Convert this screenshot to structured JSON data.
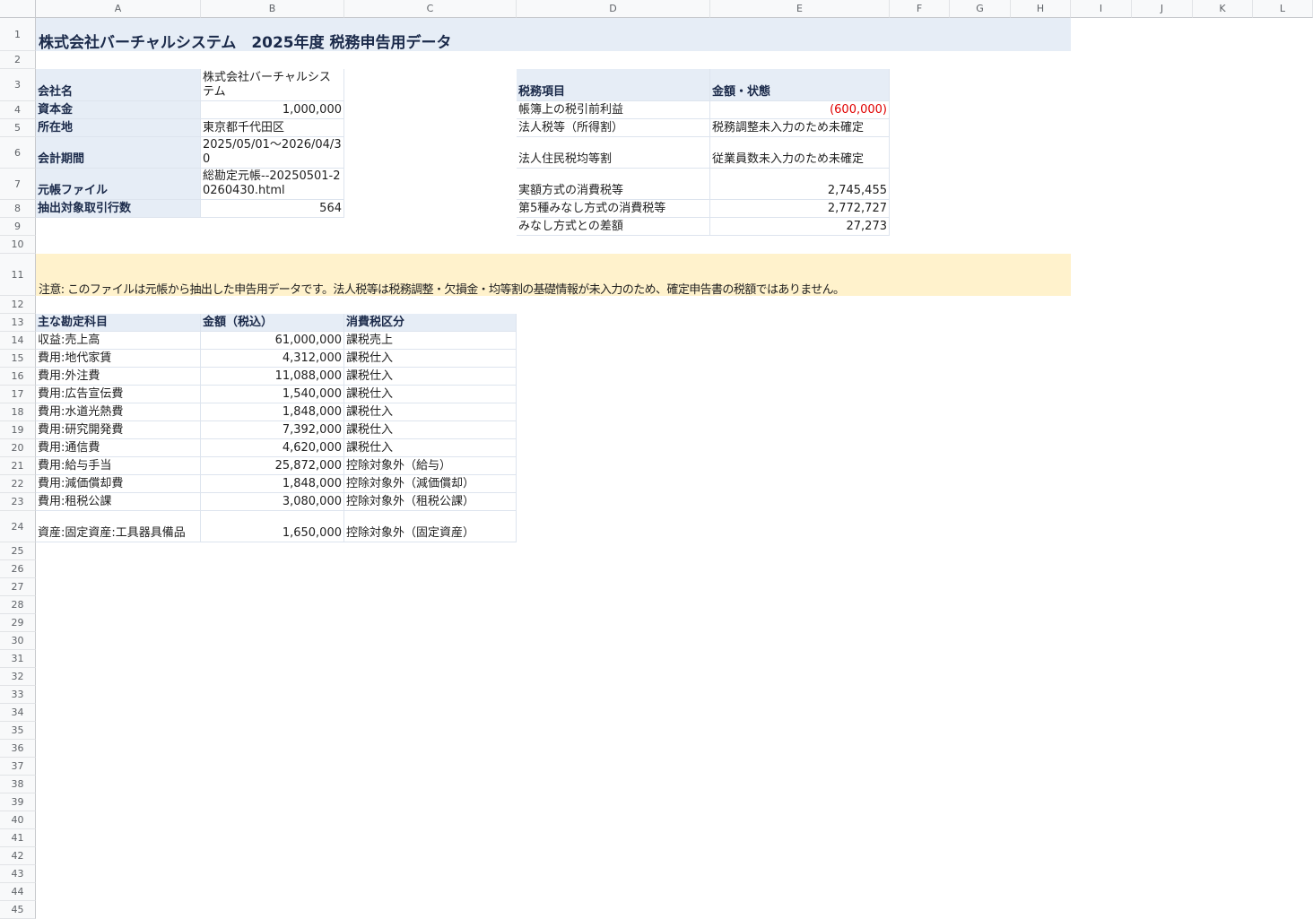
{
  "columns": [
    "A",
    "B",
    "C",
    "D",
    "E",
    "F",
    "G",
    "H",
    "I",
    "J",
    "K",
    "L"
  ],
  "rows": [
    "1",
    "2",
    "3",
    "4",
    "5",
    "6",
    "7",
    "8",
    "9",
    "10",
    "11",
    "12",
    "13",
    "14",
    "15",
    "16",
    "17",
    "18",
    "19",
    "20",
    "21",
    "22",
    "23",
    "24",
    "25",
    "26",
    "27",
    "28",
    "29",
    "30",
    "31",
    "32",
    "33",
    "34",
    "35",
    "36",
    "37",
    "38",
    "39",
    "40",
    "41",
    "42",
    "43",
    "44",
    "45"
  ],
  "title": "株式会社バーチャルシステム　2025年度 税務申告用データ",
  "company": {
    "labels": [
      "会社名",
      "資本金",
      "所在地",
      "会計期間",
      "元帳ファイル",
      "抽出対象取引行数"
    ],
    "values": [
      "株式会社バーチャルシステム",
      "1,000,000",
      "東京都千代田区",
      "2025/05/01〜2026/04/30",
      "総勘定元帳--20250501-20260430.html",
      "564"
    ]
  },
  "tax": {
    "header_item": "税務項目",
    "header_value": "金額・状態",
    "items": [
      "帳簿上の税引前利益",
      "法人税等（所得割）",
      "法人住民税均等割",
      "実額方式の消費税等",
      "第5種みなし方式の消費税等",
      "みなし方式との差額"
    ],
    "values": [
      "(600,000)",
      "税務調整未入力のため未確定",
      "従業員数未入力のため未確定",
      "2,745,455",
      "2,772,727",
      "27,273"
    ]
  },
  "note": "注意: このファイルは元帳から抽出した申告用データです。法人税等は税務調整・欠損金・均等割の基礎情報が未入力のため、確定申告書の税額ではありません。",
  "accounts": {
    "headers": [
      "主な勘定科目",
      "金額（税込）",
      "消費税区分"
    ],
    "rows": [
      {
        "name": "収益:売上高",
        "amount": "61,000,000",
        "tax": "課税売上"
      },
      {
        "name": "費用:地代家賃",
        "amount": "4,312,000",
        "tax": "課税仕入"
      },
      {
        "name": "費用:外注費",
        "amount": "11,088,000",
        "tax": "課税仕入"
      },
      {
        "name": "費用:広告宣伝費",
        "amount": "1,540,000",
        "tax": "課税仕入"
      },
      {
        "name": "費用:水道光熱費",
        "amount": "1,848,000",
        "tax": "課税仕入"
      },
      {
        "name": "費用:研究開発費",
        "amount": "7,392,000",
        "tax": "課税仕入"
      },
      {
        "name": "費用:通信費",
        "amount": "4,620,000",
        "tax": "課税仕入"
      },
      {
        "name": "費用:給与手当",
        "amount": "25,872,000",
        "tax": "控除対象外（給与）"
      },
      {
        "name": "費用:減価償却費",
        "amount": "1,848,000",
        "tax": "控除対象外（減価償却）"
      },
      {
        "name": "費用:租税公課",
        "amount": "3,080,000",
        "tax": "控除対象外（租税公課）"
      },
      {
        "name": "資産:固定資産:工具器具備品",
        "amount": "1,650,000",
        "tax": "控除対象外（固定資産）"
      }
    ]
  },
  "colors": {
    "label_fill": "#e6edf6",
    "note_fill": "#fff2cc",
    "negative": "#e00000"
  }
}
